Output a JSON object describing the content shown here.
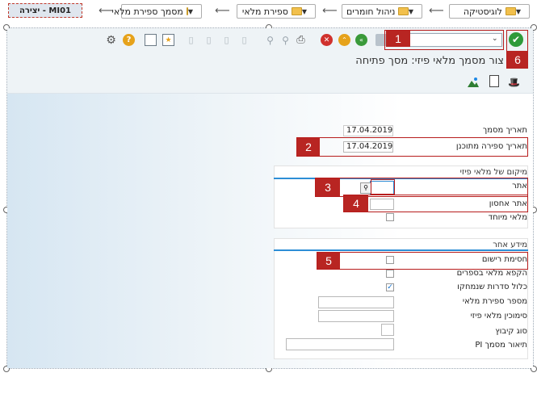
{
  "breadcrumb": {
    "items": [
      {
        "label": "לוגיסטיקה"
      },
      {
        "label": "ניהול חומרים"
      },
      {
        "label": "ספירת מלאי"
      },
      {
        "label": "מסמך ספירת מלאי"
      }
    ],
    "transaction": "MI01 - יצירה"
  },
  "toolbar": {
    "command_field": "",
    "icons": [
      "enter-icon",
      "command-dropdown",
      "save-icon",
      "back-icon",
      "exit-icon",
      "cancel-icon",
      "print-icon",
      "find-icon",
      "find-next-icon",
      "first-page-icon",
      "prev-page-icon",
      "next-page-icon",
      "last-page-icon",
      "create-session-icon",
      "shortcut-icon",
      "help-icon",
      "settings-icon"
    ]
  },
  "title": "צור מסמך מלאי פיזי: מסך פתיחה",
  "form": {
    "document_date": {
      "label": "תאריך מסמך",
      "value": "17.04.2019"
    },
    "planned_count_date": {
      "label": "תאריך ספירה מתוכנן",
      "value": "17.04.2019"
    },
    "location_section": "מיקום של מלאי פיזי",
    "plant": {
      "label": "אתר",
      "value": ""
    },
    "storage_location": {
      "label": "אתר אחסון",
      "value": ""
    },
    "special_stock": {
      "label": "מלאי מיוחד",
      "checked": false
    },
    "other_section": "מידע אחר",
    "posting_block": {
      "label": "חסימת רישום",
      "checked": false
    },
    "freeze_book_inv": {
      "label": "הקפא מלאי בספרים",
      "checked": false
    },
    "include_deleted": {
      "label": "כלול סדרות שנמחקו",
      "checked": true
    },
    "phys_inv_number": {
      "label": "מספר ספירת מלאי",
      "value": ""
    },
    "phys_inv_ref": {
      "label": "סימוכין מלאי פיזי",
      "value": ""
    },
    "grouping_type": {
      "label": "סוג קיבוץ",
      "value": ""
    },
    "pi_doc_desc": {
      "label": "תיאור מסמך PI",
      "value": ""
    }
  },
  "callouts": [
    "1",
    "2",
    "3",
    "4",
    "5",
    "6"
  ],
  "colors": {
    "callout": "#b82522",
    "section_line": "#2d8ed6",
    "enter_green": "#2e9a3a"
  }
}
